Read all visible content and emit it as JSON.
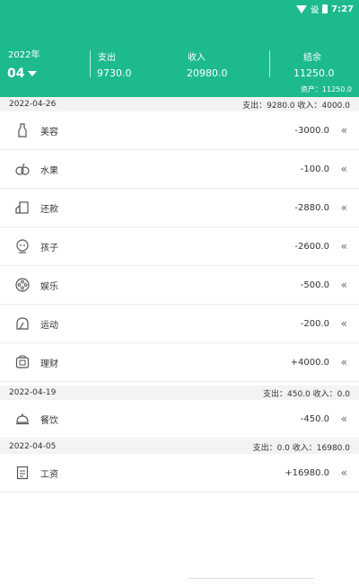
{
  "status": {
    "time": "7:27",
    "signal_text": "设"
  },
  "header": {
    "year": "2022年",
    "month": "04",
    "expense_label": "支出",
    "expense_value": "9730.0",
    "income_label": "收入",
    "income_value": "20980.0",
    "balance_label": "结余",
    "balance_value": "11250.0",
    "assets": "资产：11250.0"
  },
  "groups": [
    {
      "date": "2022-04-26",
      "summary": "支出：9280.0 收入：4000.0",
      "items": [
        {
          "label": "美容",
          "amount": "-3000.0",
          "icon": "beauty-icon"
        },
        {
          "label": "水果",
          "amount": "-100.0",
          "icon": "fruit-icon"
        },
        {
          "label": "还款",
          "amount": "-2880.0",
          "icon": "repayment-icon"
        },
        {
          "label": "孩子",
          "amount": "-2600.0",
          "icon": "child-icon"
        },
        {
          "label": "娱乐",
          "amount": "-500.0",
          "icon": "entertainment-icon"
        },
        {
          "label": "运动",
          "amount": "-200.0",
          "icon": "sport-icon"
        },
        {
          "label": "理财",
          "amount": "+4000.0",
          "icon": "finance-icon"
        }
      ]
    },
    {
      "date": "2022-04-19",
      "summary": "支出：450.0 收入：0.0",
      "items": [
        {
          "label": "餐饮",
          "amount": "-450.0",
          "icon": "dining-icon"
        }
      ]
    },
    {
      "date": "2022-04-05",
      "summary": "支出：0.0 收入：16980.0",
      "items": [
        {
          "label": "工资",
          "amount": "+16980.0",
          "icon": "salary-icon"
        }
      ]
    }
  ],
  "chevron": "«"
}
